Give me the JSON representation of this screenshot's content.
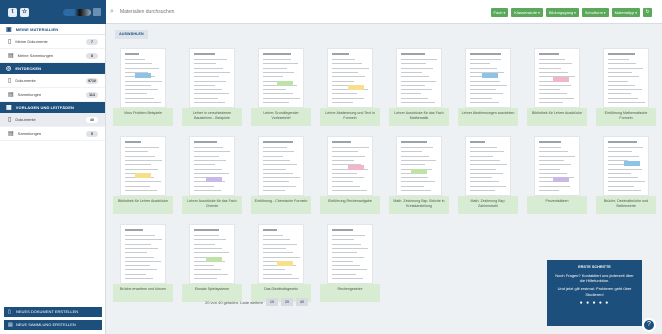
{
  "header": {
    "search_placeholder": "Materialien durchsuchen",
    "filters": [
      "Fach",
      "Klassenstufe",
      "Bildungsgang",
      "Schulform",
      "Materialtyp"
    ]
  },
  "sidebar": {
    "sections": [
      {
        "title": "MEINE MATERIALIEN",
        "style": "red",
        "items": [
          {
            "label": "Meine Dokumente",
            "count": "7"
          },
          {
            "label": "Meine Sammlungen",
            "count": "8"
          }
        ]
      },
      {
        "title": "ENTDECKEN",
        "style": "dark",
        "items": [
          {
            "label": "Dokumente",
            "count": "9710"
          },
          {
            "label": "Sammlungen",
            "count": "114"
          }
        ]
      },
      {
        "title": "VORLAGEN UND LEITFÄDEN",
        "style": "dark",
        "items": [
          {
            "label": "Dokumente",
            "count": "40",
            "active": true
          },
          {
            "label": "Sammlungen",
            "count": "5"
          }
        ]
      }
    ],
    "new_document": "NEUES DOKUMENT ERSTELLEN",
    "new_collection": "NEUE SAMMLUNG ERSTELLEN"
  },
  "content": {
    "select_label": "AUSWÄHLEN",
    "cards": [
      "Virus Problem Beispiele",
      "Lehrer in verschiedenen Bausteinen - Beispiele",
      "Lehrer Grundlegender Vorlesebrief",
      "Lehrer Abstimmung und Text in Formeln",
      "Lehrer Ausdrücke für das Fach Mathematik",
      "Lehrer Abstimmungen ausrichten",
      "Bibliothek für Lehrer Ausdrücke",
      "Einführung Mathematische Formeln",
      "Bibliothek für Lehrer Ausdrücke",
      "Lehrer Ausdrücke für das Fach Chemie",
      "Einführung - Chemische Formeln",
      "Einführung Rechenaufgabe",
      "Math. Zeichnung Bsp. Brüche in Kreisdarstellung",
      "Math. Zeichnung Bsp. Zahlenstrahl",
      "Prozentsätzen",
      "Brüche, Dezimalbrüche und Stellenwerte",
      "Brüche erweitern und kürzen",
      "Einsatz Spielsysteme",
      "Das Distributivgesetz",
      "Rechengesetze"
    ]
  },
  "pager": {
    "status": "20 von 40 geladen. Lade weitere",
    "options": [
      "10",
      "20",
      "40"
    ]
  },
  "help": {
    "title": "ERSTE SCHRITTE",
    "text1": "Noch Fragen? Kontaktiert uns jederzeit über die Hilfefunktion.",
    "text2": "Und jetzt gilt erstmal: Probieren geht über Studieren!",
    "dots": "● ● ● ● ●"
  }
}
